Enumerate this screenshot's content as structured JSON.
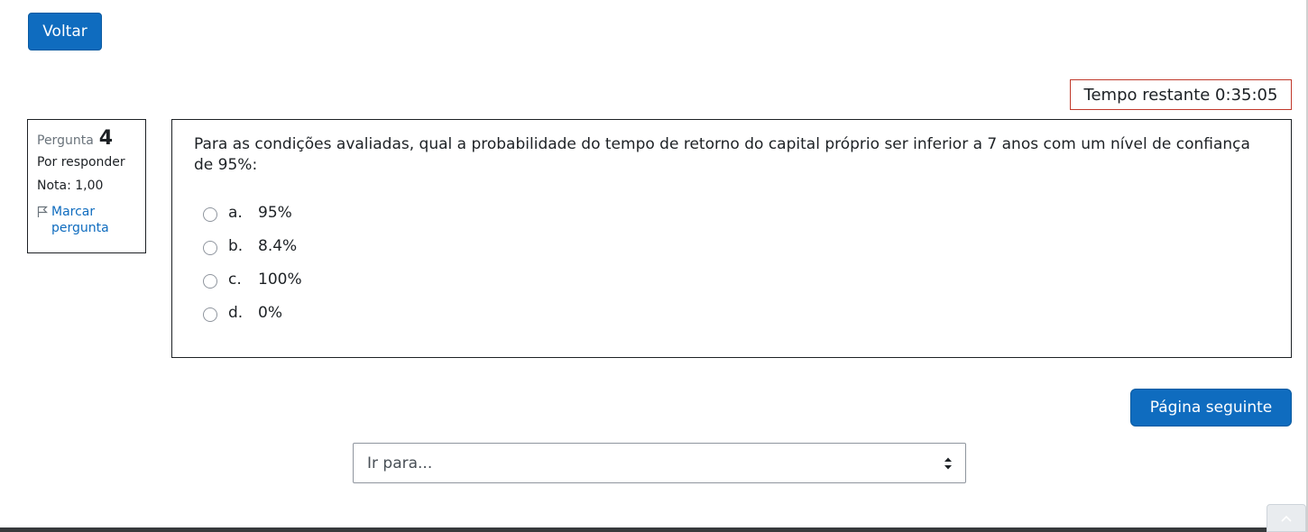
{
  "nav": {
    "back_label": "Voltar"
  },
  "timer": {
    "text": "Tempo restante 0:35:05"
  },
  "question_info": {
    "label": "Pergunta",
    "number": "4",
    "state": "Por responder",
    "grade": "Nota: 1,00",
    "flag_label": "Marcar pergunta"
  },
  "question": {
    "text": "Para as condições avaliadas, qual a probabilidade do tempo de retorno do capital próprio ser inferior a 7 anos com um nível de confiança de 95%:",
    "answers": [
      {
        "letter": "a.",
        "text": "95%"
      },
      {
        "letter": "b.",
        "text": "8.4%"
      },
      {
        "letter": "c.",
        "text": "100%"
      },
      {
        "letter": "d.",
        "text": "0%"
      }
    ]
  },
  "next_button": {
    "label": "Página seguinte"
  },
  "jump_select": {
    "value": "Ir para..."
  },
  "icons": {
    "flag": "flag-icon",
    "select_arrows": "sort-arrows-icon",
    "back_to_top": "chevron-up-icon"
  },
  "colors": {
    "primary": "#0f6cbf",
    "timer_border": "#c0392b",
    "text": "#1d2125"
  }
}
